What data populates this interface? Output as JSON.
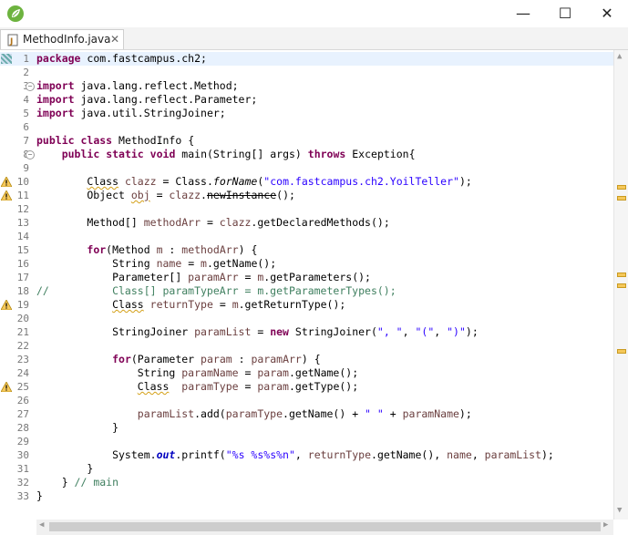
{
  "window": {
    "app_icon": "spring-leaf-icon",
    "minimize_glyph": "—",
    "maximize_glyph": "☐",
    "close_glyph": "✕"
  },
  "tab": {
    "filename": "MethodInfo.java",
    "icon": "java-file-icon",
    "close_glyph": "✕"
  },
  "view_controls": {
    "minimize_glyph": "▭",
    "maximize_glyph": "☐"
  },
  "colors": {
    "keyword": "#7f0055",
    "string": "#2a00ff",
    "comment": "#3f7f5f",
    "local_variable": "#6a3e3e",
    "static_field": "#0000c0",
    "current_line": "#e8f2fe",
    "warning": "#d4a017"
  },
  "lines": [
    {
      "n": "1",
      "fold": false,
      "warn": false,
      "tokens": [
        {
          "t": "package",
          "c": "kw"
        },
        {
          "t": " com.fastcampus.ch2;"
        }
      ]
    },
    {
      "n": "2",
      "fold": false,
      "warn": false,
      "tokens": []
    },
    {
      "n": "3",
      "fold": true,
      "warn": false,
      "tokens": [
        {
          "t": "import",
          "c": "kw"
        },
        {
          "t": " java.lang.reflect.Method;"
        }
      ]
    },
    {
      "n": "4",
      "fold": false,
      "warn": false,
      "tokens": [
        {
          "t": "import",
          "c": "kw"
        },
        {
          "t": " java.lang.reflect.Parameter;"
        }
      ]
    },
    {
      "n": "5",
      "fold": false,
      "warn": false,
      "tokens": [
        {
          "t": "import",
          "c": "kw"
        },
        {
          "t": " java.util.StringJoiner;"
        }
      ]
    },
    {
      "n": "6",
      "fold": false,
      "warn": false,
      "tokens": []
    },
    {
      "n": "7",
      "fold": false,
      "warn": false,
      "tokens": [
        {
          "t": "public",
          "c": "kw"
        },
        {
          "t": " "
        },
        {
          "t": "class",
          "c": "kw"
        },
        {
          "t": " MethodInfo {"
        }
      ]
    },
    {
      "n": "8",
      "fold": true,
      "warn": false,
      "tokens": [
        {
          "t": "    "
        },
        {
          "t": "public",
          "c": "kw"
        },
        {
          "t": " "
        },
        {
          "t": "static",
          "c": "kw"
        },
        {
          "t": " "
        },
        {
          "t": "void",
          "c": "kw"
        },
        {
          "t": " main(String[] args) "
        },
        {
          "t": "throws",
          "c": "kw"
        },
        {
          "t": " Exception{"
        }
      ]
    },
    {
      "n": "9",
      "fold": false,
      "warn": false,
      "tokens": []
    },
    {
      "n": "10",
      "fold": false,
      "warn": true,
      "tokens": [
        {
          "t": "        "
        },
        {
          "t": "Class",
          "c": "warn"
        },
        {
          "t": " "
        },
        {
          "t": "clazz",
          "c": "var"
        },
        {
          "t": " = Class."
        },
        {
          "t": "forName",
          "c": "it"
        },
        {
          "t": "("
        },
        {
          "t": "\"com.fastcampus.ch2.YoilTeller\"",
          "c": "str"
        },
        {
          "t": ");"
        }
      ]
    },
    {
      "n": "11",
      "fold": false,
      "warn": true,
      "tokens": [
        {
          "t": "        Object "
        },
        {
          "t": "obj",
          "c": "var warn"
        },
        {
          "t": " = "
        },
        {
          "t": "clazz",
          "c": "var"
        },
        {
          "t": "."
        },
        {
          "t": "newInstance",
          "c": "strike"
        },
        {
          "t": "();"
        }
      ]
    },
    {
      "n": "12",
      "fold": false,
      "warn": false,
      "tokens": []
    },
    {
      "n": "13",
      "fold": false,
      "warn": false,
      "tokens": [
        {
          "t": "        Method[] "
        },
        {
          "t": "methodArr",
          "c": "var"
        },
        {
          "t": " = "
        },
        {
          "t": "clazz",
          "c": "var"
        },
        {
          "t": ".getDeclaredMethods();"
        }
      ]
    },
    {
      "n": "14",
      "fold": false,
      "warn": false,
      "tokens": []
    },
    {
      "n": "15",
      "fold": false,
      "warn": false,
      "tokens": [
        {
          "t": "        "
        },
        {
          "t": "for",
          "c": "kw"
        },
        {
          "t": "(Method "
        },
        {
          "t": "m",
          "c": "var"
        },
        {
          "t": " : "
        },
        {
          "t": "methodArr",
          "c": "var"
        },
        {
          "t": ") {"
        }
      ]
    },
    {
      "n": "16",
      "fold": false,
      "warn": false,
      "tokens": [
        {
          "t": "            String "
        },
        {
          "t": "name",
          "c": "var"
        },
        {
          "t": " = "
        },
        {
          "t": "m",
          "c": "var"
        },
        {
          "t": ".getName();"
        }
      ]
    },
    {
      "n": "17",
      "fold": false,
      "warn": false,
      "tokens": [
        {
          "t": "            Parameter[] "
        },
        {
          "t": "paramArr",
          "c": "var"
        },
        {
          "t": " = "
        },
        {
          "t": "m",
          "c": "var"
        },
        {
          "t": ".getParameters();"
        }
      ]
    },
    {
      "n": "18",
      "fold": false,
      "warn": false,
      "tokens": [
        {
          "t": "//          Class[] paramTypeArr = m.getParameterTypes();",
          "c": "cm"
        }
      ]
    },
    {
      "n": "19",
      "fold": false,
      "warn": true,
      "tokens": [
        {
          "t": "            "
        },
        {
          "t": "Class",
          "c": "warn"
        },
        {
          "t": " "
        },
        {
          "t": "returnType",
          "c": "var"
        },
        {
          "t": " = "
        },
        {
          "t": "m",
          "c": "var"
        },
        {
          "t": ".getReturnType();"
        }
      ]
    },
    {
      "n": "20",
      "fold": false,
      "warn": false,
      "tokens": []
    },
    {
      "n": "21",
      "fold": false,
      "warn": false,
      "tokens": [
        {
          "t": "            StringJoiner "
        },
        {
          "t": "paramList",
          "c": "var"
        },
        {
          "t": " = "
        },
        {
          "t": "new",
          "c": "kw"
        },
        {
          "t": " StringJoiner("
        },
        {
          "t": "\", \"",
          "c": "str"
        },
        {
          "t": ", "
        },
        {
          "t": "\"(\"",
          "c": "str"
        },
        {
          "t": ", "
        },
        {
          "t": "\")\"",
          "c": "str"
        },
        {
          "t": ");"
        }
      ]
    },
    {
      "n": "22",
      "fold": false,
      "warn": false,
      "tokens": []
    },
    {
      "n": "23",
      "fold": false,
      "warn": false,
      "tokens": [
        {
          "t": "            "
        },
        {
          "t": "for",
          "c": "kw"
        },
        {
          "t": "(Parameter "
        },
        {
          "t": "param",
          "c": "var"
        },
        {
          "t": " : "
        },
        {
          "t": "paramArr",
          "c": "var"
        },
        {
          "t": ") {"
        }
      ]
    },
    {
      "n": "24",
      "fold": false,
      "warn": false,
      "tokens": [
        {
          "t": "                String "
        },
        {
          "t": "paramName",
          "c": "var"
        },
        {
          "t": " = "
        },
        {
          "t": "param",
          "c": "var"
        },
        {
          "t": ".getName();"
        }
      ]
    },
    {
      "n": "25",
      "fold": false,
      "warn": true,
      "tokens": [
        {
          "t": "                "
        },
        {
          "t": "Class",
          "c": "warn"
        },
        {
          "t": "  "
        },
        {
          "t": "paramType",
          "c": "var"
        },
        {
          "t": " = "
        },
        {
          "t": "param",
          "c": "var"
        },
        {
          "t": ".getType();"
        }
      ]
    },
    {
      "n": "26",
      "fold": false,
      "warn": false,
      "tokens": []
    },
    {
      "n": "27",
      "fold": false,
      "warn": false,
      "tokens": [
        {
          "t": "                "
        },
        {
          "t": "paramList",
          "c": "var"
        },
        {
          "t": ".add("
        },
        {
          "t": "paramType",
          "c": "var"
        },
        {
          "t": ".getName() + "
        },
        {
          "t": "\" \"",
          "c": "str"
        },
        {
          "t": " + "
        },
        {
          "t": "paramName",
          "c": "var"
        },
        {
          "t": ");"
        }
      ]
    },
    {
      "n": "28",
      "fold": false,
      "warn": false,
      "tokens": [
        {
          "t": "            }"
        }
      ]
    },
    {
      "n": "29",
      "fold": false,
      "warn": false,
      "tokens": []
    },
    {
      "n": "30",
      "fold": false,
      "warn": false,
      "tokens": [
        {
          "t": "            System."
        },
        {
          "t": "out",
          "c": "sf"
        },
        {
          "t": ".printf("
        },
        {
          "t": "\"%s %s%s%n\"",
          "c": "str"
        },
        {
          "t": ", "
        },
        {
          "t": "returnType",
          "c": "var"
        },
        {
          "t": ".getName(), "
        },
        {
          "t": "name",
          "c": "var"
        },
        {
          "t": ", "
        },
        {
          "t": "paramList",
          "c": "var"
        },
        {
          "t": ");"
        }
      ]
    },
    {
      "n": "31",
      "fold": false,
      "warn": false,
      "tokens": [
        {
          "t": "        }"
        }
      ]
    },
    {
      "n": "32",
      "fold": false,
      "warn": false,
      "tokens": [
        {
          "t": "    } "
        },
        {
          "t": "// main",
          "c": "cm"
        }
      ]
    },
    {
      "n": "33",
      "fold": false,
      "warn": false,
      "tokens": [
        {
          "t": "}"
        }
      ]
    }
  ],
  "overview_marks": [
    10,
    11,
    18,
    19,
    25
  ]
}
